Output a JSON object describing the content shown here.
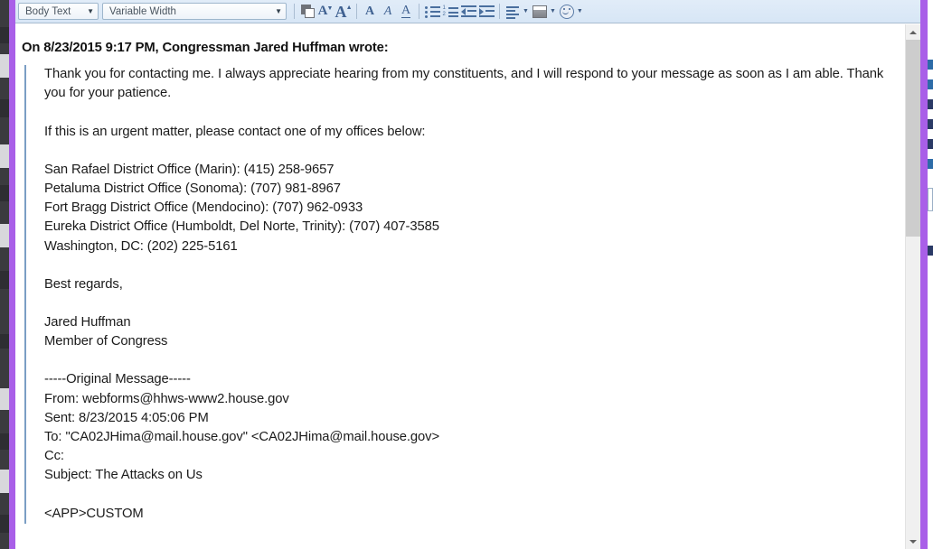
{
  "window": {
    "accent_color": "#a95fe8",
    "toolbar_bg": "#dce8f6"
  },
  "toolbar": {
    "style_select": {
      "value": "Body Text",
      "caret": "▼"
    },
    "font_select": {
      "value": "Variable Width",
      "caret": "▼"
    },
    "buttons": {
      "font_color": "Font Color",
      "decrease_size": "A",
      "decrease_caret": "▼",
      "increase_size": "A",
      "increase_caret": "▲",
      "bold": "A",
      "italic": "A",
      "underline": "A",
      "bullet_list": "Bulleted List",
      "numbered_list_1": "1",
      "numbered_list_2": "2",
      "outdent": "Decrease Indent",
      "indent": "Increase Indent",
      "align": "Align",
      "align_caret": "▼",
      "highlight": "Highlight Color",
      "highlight_caret": "▼",
      "smiley": "Insert Smiley",
      "smiley_caret": "▼"
    }
  },
  "document": {
    "intro": "On 8/23/2015 9:17 PM, Congressman Jared Huffman wrote:",
    "quote": {
      "paragraph_1": "Thank you for contacting me. I always appreciate hearing from my constituents, and I will respond to your message as soon as I am able. Thank you for your patience.",
      "paragraph_2": "If this is an urgent matter, please contact one of my offices below:",
      "offices": [
        "San Rafael District Office (Marin): (415) 258-9657",
        "Petaluma District Office (Sonoma): (707) 981-8967",
        "Fort Bragg District Office (Mendocino): (707) 962-0933",
        "Eureka District Office (Humboldt, Del Norte, Trinity): (707) 407-3585",
        "Washington, DC: (202) 225-5161"
      ],
      "closing": "Best regards,",
      "signature": [
        "Jared Huffman",
        "Member of Congress"
      ],
      "original_divider": "-----Original Message-----",
      "headers": [
        "From: webforms@hhws-www2.house.gov",
        "Sent: 8/23/2015 4:05:06 PM",
        "To: \"CA02JHima@mail.house.gov\" <CA02JHima@mail.house.gov>",
        "Cc:",
        "Subject: The Attacks on Us"
      ],
      "app_custom": "<APP>CUSTOM"
    }
  },
  "scrollbar": {
    "up_arrow": "▲",
    "down_arrow": "▼"
  }
}
